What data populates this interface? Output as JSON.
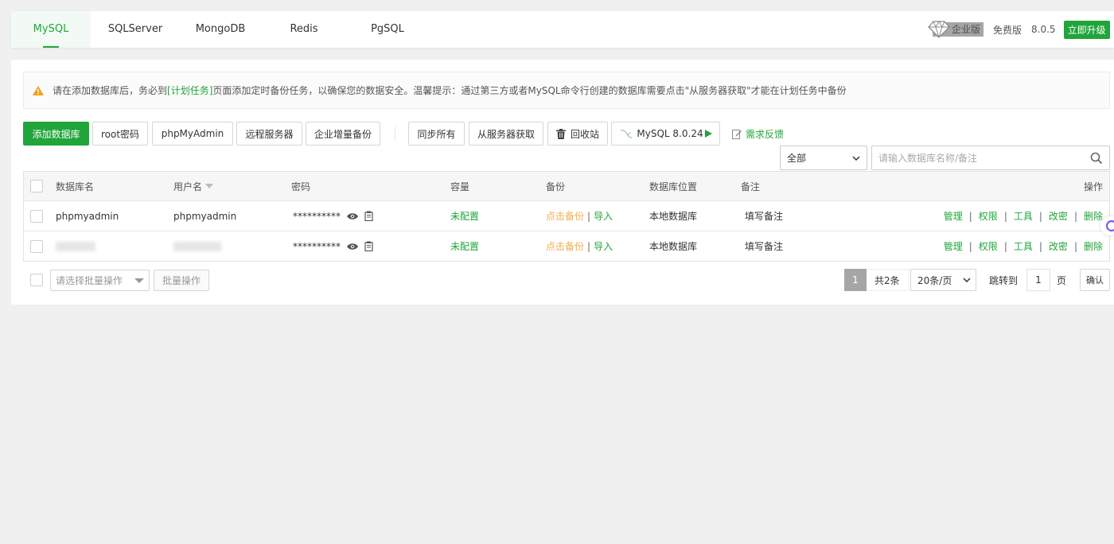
{
  "tabs": [
    {
      "label": "MySQL",
      "active": true
    },
    {
      "label": "SQLServer"
    },
    {
      "label": "MongoDB"
    },
    {
      "label": "Redis"
    },
    {
      "label": "PgSQL"
    }
  ],
  "edition": {
    "enterprise": "企业版",
    "free": "免费版",
    "version": "8.0.5",
    "upgrade": "立即升级"
  },
  "alert": {
    "text_before": "请在添加数据库后，务必到",
    "link": "[计划任务]",
    "text_after": "页面添加定时备份任务，以确保您的数据安全。温馨提示：通过第三方或者MySQL命令行创建的数据库需要点击\"从服务器获取\"才能在计划任务中备份"
  },
  "toolbar": {
    "add_db": "添加数据库",
    "root_pwd": "root密码",
    "phpmyadmin": "phpMyAdmin",
    "remote": "远程服务器",
    "incremental": "企业增量备份",
    "sync_all": "同步所有",
    "fetch": "从服务器获取",
    "recycle": "回收站",
    "mysql_version": "MySQL 8.0.24",
    "feedback": "需求反馈"
  },
  "filter": {
    "scope": "全部",
    "search_placeholder": "请输入数据库名称/备注"
  },
  "table": {
    "headers": {
      "name": "数据库名",
      "user": "用户名",
      "password": "密码",
      "capacity": "容量",
      "backup": "备份",
      "location": "数据库位置",
      "remark": "备注",
      "ops": "操作"
    },
    "rows": [
      {
        "name": "phpmyadmin",
        "user": "phpmyadmin",
        "password": "**********",
        "capacity": "未配置",
        "backup": "点击备份",
        "import": "导入",
        "location": "本地数据库",
        "remark": "填写备注",
        "ops": [
          "管理",
          "权限",
          "工具",
          "改密",
          "删除"
        ]
      },
      {
        "name": "",
        "user": "",
        "password": "**********",
        "capacity": "未配置",
        "backup": "点击备份",
        "import": "导入",
        "location": "本地数据库",
        "remark": "填写备注",
        "ops": [
          "管理",
          "权限",
          "工具",
          "改密",
          "删除"
        ]
      }
    ]
  },
  "footer": {
    "batch_placeholder": "请选择批量操作",
    "batch_btn": "批量操作",
    "current_page": "1",
    "total": "共2条",
    "page_size": "20条/页",
    "jump_label": "跳转到",
    "jump_value": "1",
    "page_unit": "页",
    "confirm": "确认"
  },
  "colors": {
    "accent": "#20a53a",
    "warning": "#f0ad4e"
  }
}
